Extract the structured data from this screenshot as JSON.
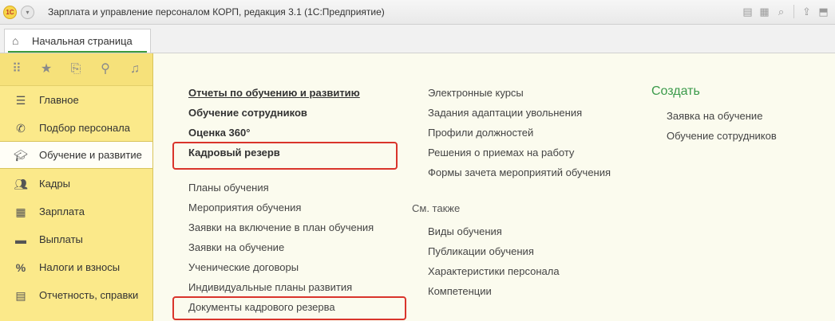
{
  "window": {
    "title": "Зарплата и управление персоналом КОРП, редакция 3.1  (1С:Предприятие)",
    "logo_text": "1С"
  },
  "tabs": {
    "home_label": "Начальная страница"
  },
  "sidebar": {
    "items": [
      {
        "label": "Главное",
        "icon": "menu-lines-icon"
      },
      {
        "label": "Подбор персонала",
        "icon": "phone-icon"
      },
      {
        "label": "Обучение и развитие",
        "icon": "graduation-cap-icon",
        "active": true
      },
      {
        "label": "Кадры",
        "icon": "people-icon"
      },
      {
        "label": "Зарплата",
        "icon": "calculator-icon"
      },
      {
        "label": "Выплаты",
        "icon": "wallet-icon"
      },
      {
        "label": "Налоги и взносы",
        "icon": "percent-icon"
      },
      {
        "label": "Отчетность, справки",
        "icon": "report-icon"
      }
    ]
  },
  "main": {
    "col1_top": [
      "Отчеты по обучению и развитию",
      "Обучение сотрудников",
      "Оценка 360°",
      "Кадровый резерв"
    ],
    "col1_bottom": [
      "Планы обучения",
      "Мероприятия обучения",
      "Заявки на включение в план обучения",
      "Заявки на обучение",
      "Ученические договоры",
      "Индивидуальные планы развития",
      "Документы кадрового резерва"
    ],
    "col2_top": [
      "Электронные курсы",
      "Задания адаптации увольнения",
      "Профили должностей",
      "Решения о приемах на работу",
      "Формы зачета мероприятий обучения"
    ],
    "see_also_heading": "См. также",
    "col2_bottom": [
      "Виды обучения",
      "Публикации обучения",
      "Характеристики персонала",
      "Компетенции"
    ],
    "create_heading": "Создать",
    "create_items": [
      "Заявка на обучение",
      "Обучение сотрудников"
    ]
  },
  "colors": {
    "sidebar_bg": "#fbe98a",
    "content_bg": "#fbfbee",
    "highlight": "#d9342b",
    "create_green": "#3a9a4a"
  }
}
